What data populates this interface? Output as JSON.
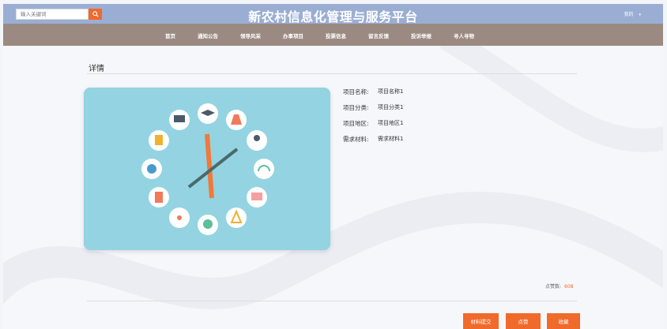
{
  "header": {
    "search_placeholder": "输入关键词",
    "site_title": "新农村信息化管理与服务平台",
    "user_label": "我的"
  },
  "nav": {
    "items": [
      "首页",
      "通知公告",
      "领导风采",
      "办事项目",
      "投票信息",
      "留言反馈",
      "投诉举报",
      "寻人寻物"
    ]
  },
  "detail": {
    "heading": "详情",
    "fields": [
      {
        "label": "项目名称:",
        "value": "项目名称1"
      },
      {
        "label": "项目分类:",
        "value": "项目分类1"
      },
      {
        "label": "项目地区:",
        "value": "项目地区1"
      },
      {
        "label": "需求材料:",
        "value": "需求材料1"
      }
    ],
    "likes_label": "点赞数:",
    "likes_count": "608"
  },
  "actions": {
    "submit_label": "材料提交",
    "like_label": "点赞",
    "favorite_label": "收藏"
  },
  "colors": {
    "topbar": "#9aaed4",
    "navbar": "#9b8a81",
    "accent": "#f06a2b",
    "image_bg": "#94d3e2"
  }
}
